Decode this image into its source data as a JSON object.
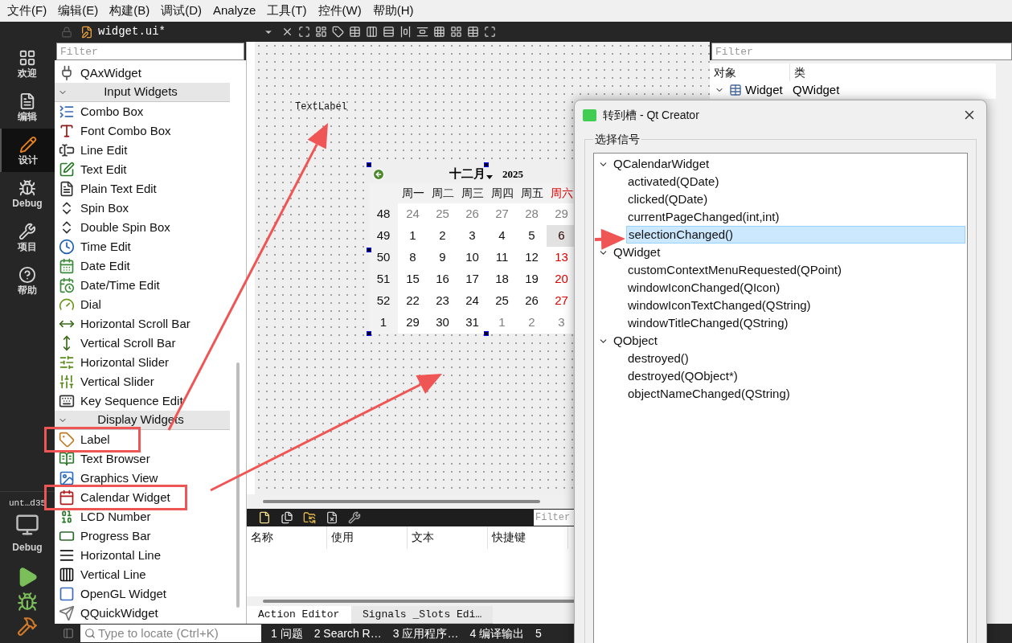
{
  "menu": [
    {
      "label": "文件(F)"
    },
    {
      "label": "编辑(E)"
    },
    {
      "label": "构建(B)"
    },
    {
      "label": "调试(D)"
    },
    {
      "label": "Analyze"
    },
    {
      "label": "工具(T)"
    },
    {
      "label": "控件(W)"
    },
    {
      "label": "帮助(H)"
    }
  ],
  "modes": [
    {
      "label": "欢迎",
      "selected": false
    },
    {
      "label": "编辑",
      "selected": false
    },
    {
      "label": "设计",
      "selected": true
    },
    {
      "label": "Debug",
      "selected": false
    },
    {
      "label": "项目",
      "selected": false
    },
    {
      "label": "帮助",
      "selected": false
    }
  ],
  "kit": {
    "project": "unt…d35",
    "mode": "Debug"
  },
  "editor_toolbar": {
    "file_name": "widget.ui*"
  },
  "widget_box": {
    "filter_placeholder": "Filter",
    "items": [
      {
        "kind": "item",
        "label": "QAxWidget",
        "annotated": false
      },
      {
        "kind": "category",
        "label": "Input Widgets",
        "expanded": true
      },
      {
        "kind": "item",
        "label": "Combo Box",
        "annotated": false
      },
      {
        "kind": "item",
        "label": "Font Combo Box",
        "annotated": false
      },
      {
        "kind": "item",
        "label": "Line Edit",
        "annotated": false
      },
      {
        "kind": "item",
        "label": "Text Edit",
        "annotated": false
      },
      {
        "kind": "item",
        "label": "Plain Text Edit",
        "annotated": false
      },
      {
        "kind": "item",
        "label": "Spin Box",
        "annotated": false
      },
      {
        "kind": "item",
        "label": "Double Spin Box",
        "annotated": false
      },
      {
        "kind": "item",
        "label": "Time Edit",
        "annotated": false
      },
      {
        "kind": "item",
        "label": "Date Edit",
        "annotated": false
      },
      {
        "kind": "item",
        "label": "Date/Time Edit",
        "annotated": false
      },
      {
        "kind": "item",
        "label": "Dial",
        "annotated": false
      },
      {
        "kind": "item",
        "label": "Horizontal Scroll Bar",
        "annotated": false
      },
      {
        "kind": "item",
        "label": "Vertical Scroll Bar",
        "annotated": false
      },
      {
        "kind": "item",
        "label": "Horizontal Slider",
        "annotated": false
      },
      {
        "kind": "item",
        "label": "Vertical Slider",
        "annotated": false
      },
      {
        "kind": "item",
        "label": "Key Sequence Edit",
        "annotated": false
      },
      {
        "kind": "category",
        "label": "Display Widgets",
        "expanded": true
      },
      {
        "kind": "item",
        "label": "Label",
        "annotated": true
      },
      {
        "kind": "item",
        "label": "Text Browser",
        "annotated": false
      },
      {
        "kind": "item",
        "label": "Graphics View",
        "annotated": false
      },
      {
        "kind": "item",
        "label": "Calendar Widget",
        "annotated": true
      },
      {
        "kind": "item",
        "label": "LCD Number",
        "annotated": false
      },
      {
        "kind": "item",
        "label": "Progress Bar",
        "annotated": false
      },
      {
        "kind": "item",
        "label": "Horizontal Line",
        "annotated": false
      },
      {
        "kind": "item",
        "label": "Vertical Line",
        "annotated": false
      },
      {
        "kind": "item",
        "label": "OpenGL Widget",
        "annotated": false
      },
      {
        "kind": "item",
        "label": "QQuickWidget",
        "annotated": false
      }
    ]
  },
  "form": {
    "text_label": "TextLabel",
    "calendar": {
      "month": "十二月",
      "year": "2025",
      "weekdays": [
        {
          "text": "周一",
          "weekend": false
        },
        {
          "text": "周二",
          "weekend": false
        },
        {
          "text": "周三",
          "weekend": false
        },
        {
          "text": "周四",
          "weekend": false
        },
        {
          "text": "周五",
          "weekend": false
        },
        {
          "text": "周六",
          "weekend": true
        }
      ],
      "weeks": [
        {
          "number": "48",
          "days": [
            {
              "text": "24",
              "kind": "other",
              "selected": false
            },
            {
              "text": "25",
              "kind": "other",
              "selected": false
            },
            {
              "text": "26",
              "kind": "other",
              "selected": false
            },
            {
              "text": "27",
              "kind": "other",
              "selected": false
            },
            {
              "text": "28",
              "kind": "other",
              "selected": false
            },
            {
              "text": "29",
              "kind": "other",
              "selected": false
            }
          ]
        },
        {
          "number": "49",
          "days": [
            {
              "text": "1",
              "kind": "normal",
              "selected": false
            },
            {
              "text": "2",
              "kind": "normal",
              "selected": false
            },
            {
              "text": "3",
              "kind": "normal",
              "selected": false
            },
            {
              "text": "4",
              "kind": "normal",
              "selected": false
            },
            {
              "text": "5",
              "kind": "normal",
              "selected": false
            },
            {
              "text": "6",
              "kind": "weekend",
              "selected": true
            }
          ]
        },
        {
          "number": "50",
          "days": [
            {
              "text": "8",
              "kind": "normal",
              "selected": false
            },
            {
              "text": "9",
              "kind": "normal",
              "selected": false
            },
            {
              "text": "10",
              "kind": "normal",
              "selected": false
            },
            {
              "text": "11",
              "kind": "normal",
              "selected": false
            },
            {
              "text": "12",
              "kind": "normal",
              "selected": false
            },
            {
              "text": "13",
              "kind": "weekend",
              "selected": false
            }
          ]
        },
        {
          "number": "51",
          "days": [
            {
              "text": "15",
              "kind": "normal",
              "selected": false
            },
            {
              "text": "16",
              "kind": "normal",
              "selected": false
            },
            {
              "text": "17",
              "kind": "normal",
              "selected": false
            },
            {
              "text": "18",
              "kind": "normal",
              "selected": false
            },
            {
              "text": "19",
              "kind": "normal",
              "selected": false
            },
            {
              "text": "20",
              "kind": "weekend",
              "selected": false
            }
          ]
        },
        {
          "number": "52",
          "days": [
            {
              "text": "22",
              "kind": "normal",
              "selected": false
            },
            {
              "text": "23",
              "kind": "normal",
              "selected": false
            },
            {
              "text": "24",
              "kind": "normal",
              "selected": false
            },
            {
              "text": "25",
              "kind": "normal",
              "selected": false
            },
            {
              "text": "26",
              "kind": "normal",
              "selected": false
            },
            {
              "text": "27",
              "kind": "weekend",
              "selected": false
            }
          ]
        },
        {
          "number": "1",
          "days": [
            {
              "text": "29",
              "kind": "normal",
              "selected": false
            },
            {
              "text": "30",
              "kind": "normal",
              "selected": false
            },
            {
              "text": "31",
              "kind": "normal",
              "selected": false
            },
            {
              "text": "1",
              "kind": "other",
              "selected": false
            },
            {
              "text": "2",
              "kind": "other",
              "selected": false
            },
            {
              "text": "3",
              "kind": "other",
              "selected": false
            }
          ]
        }
      ]
    }
  },
  "action_editor": {
    "filter_placeholder": "Filter",
    "columns": [
      "名称",
      "使用",
      "文本",
      "快捷键"
    ],
    "tabs": [
      {
        "label": "Action Editor",
        "selected": true
      },
      {
        "label": "Signals _Slots Edi…",
        "selected": false
      }
    ]
  },
  "object_inspector": {
    "filter_placeholder": "Filter",
    "columns": [
      "对象",
      "类"
    ],
    "rows": [
      {
        "object": "Widget",
        "class": "QWidget",
        "expanded": true
      }
    ]
  },
  "dialog": {
    "title": "转到槽 - Qt Creator",
    "group_label": "选择信号",
    "signals": [
      {
        "name": "QCalendarWidget",
        "expanded": true,
        "selected": false,
        "children": [
          {
            "name": "activated(QDate)",
            "selected": false
          },
          {
            "name": "clicked(QDate)",
            "selected": false
          },
          {
            "name": "currentPageChanged(int,int)",
            "selected": false
          },
          {
            "name": "selectionChanged()",
            "selected": true
          }
        ]
      },
      {
        "name": "QWidget",
        "expanded": true,
        "selected": false,
        "children": [
          {
            "name": "customContextMenuRequested(QPoint)",
            "selected": false
          },
          {
            "name": "windowIconChanged(QIcon)",
            "selected": false
          },
          {
            "name": "windowIconTextChanged(QString)",
            "selected": false
          },
          {
            "name": "windowTitleChanged(QString)",
            "selected": false
          }
        ]
      },
      {
        "name": "QObject",
        "expanded": true,
        "selected": false,
        "children": [
          {
            "name": "destroyed()",
            "selected": false
          },
          {
            "name": "destroyed(QObject*)",
            "selected": false
          },
          {
            "name": "objectNameChanged(QString)",
            "selected": false
          }
        ]
      }
    ]
  },
  "status_bar": {
    "locate_placeholder": "Type to locate (Ctrl+K)",
    "output_tabs": [
      "1 问题",
      "2 Search R…",
      "3 应用程序…",
      "4 编译输出",
      "5"
    ]
  }
}
